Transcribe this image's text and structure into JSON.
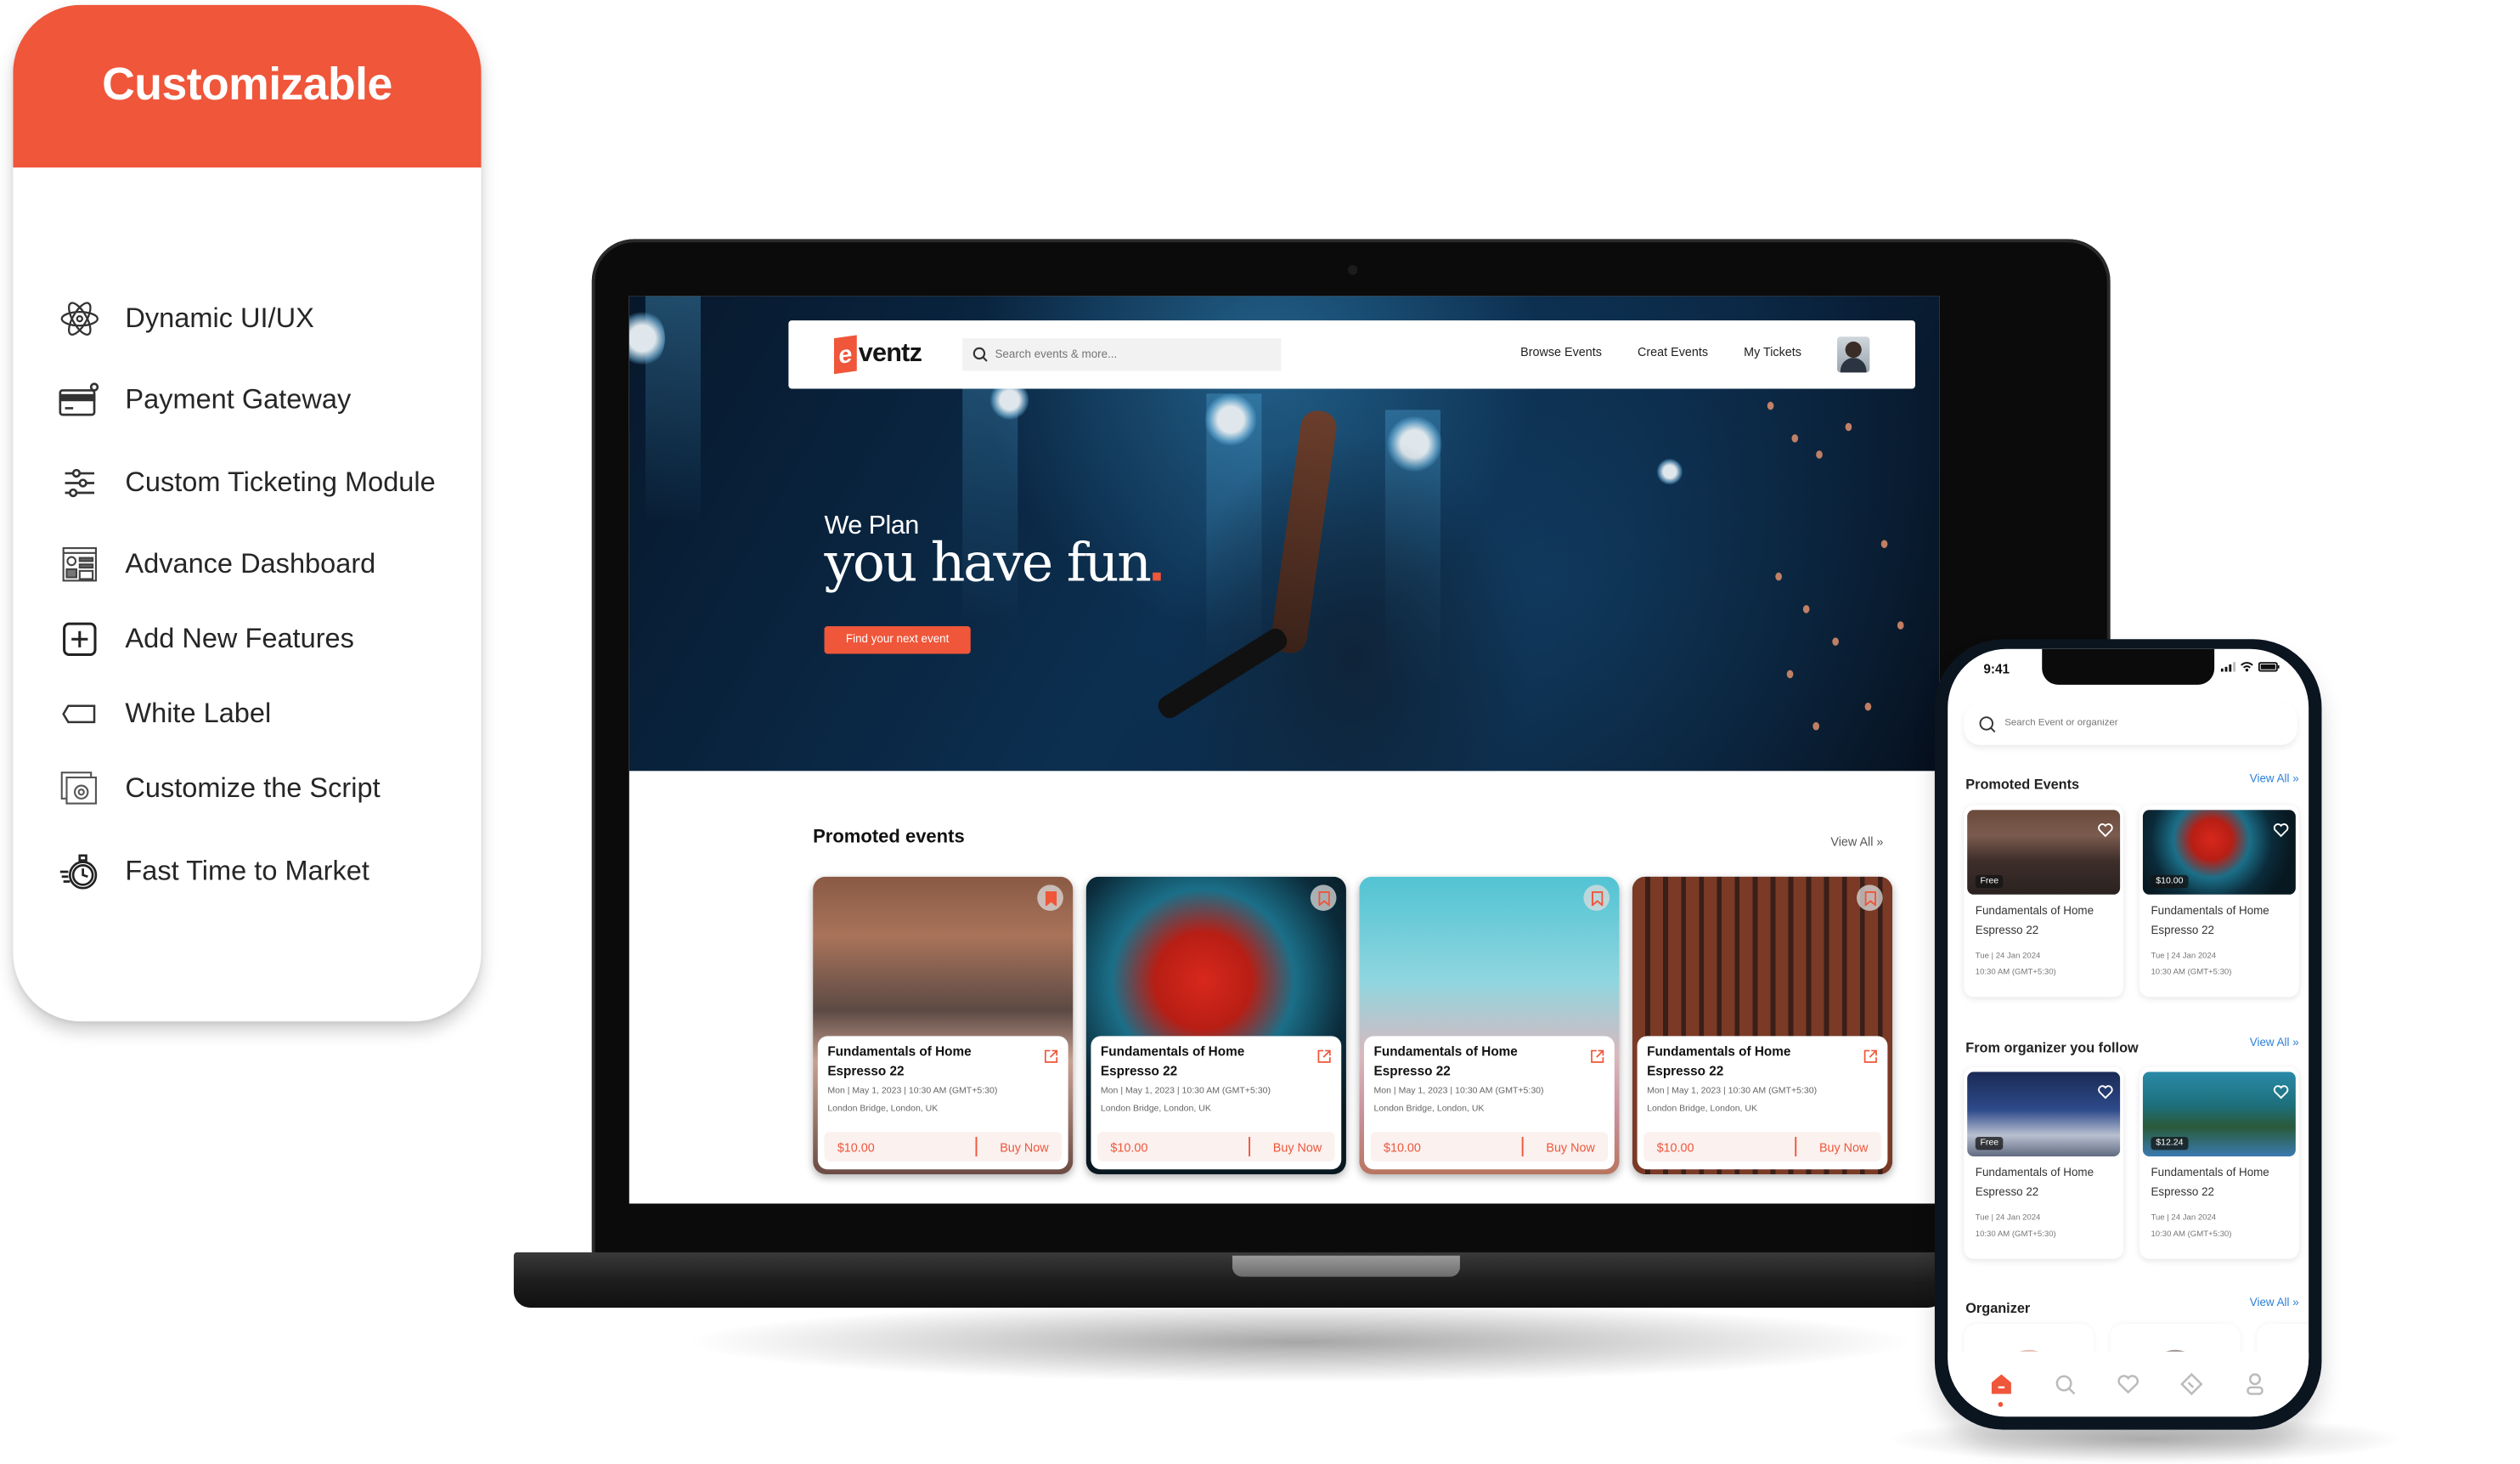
{
  "brand_color": "#ef563a",
  "link_color": "#2b7fd6",
  "feature_panel": {
    "title": "Customizable",
    "items": [
      {
        "icon": "atom-icon",
        "label": "Dynamic UI/UX"
      },
      {
        "icon": "credit-card-icon",
        "label": "Payment Gateway"
      },
      {
        "icon": "sliders-icon",
        "label": "Custom Ticketing Module"
      },
      {
        "icon": "dashboard-icon",
        "label": "Advance Dashboard"
      },
      {
        "icon": "plus-square-icon",
        "label": "Add New Features"
      },
      {
        "icon": "tag-label-icon",
        "label": "White Label"
      },
      {
        "icon": "window-gear-icon",
        "label": "Customize the Script"
      },
      {
        "icon": "stopwatch-icon",
        "label": "Fast Time to Market"
      }
    ]
  },
  "web_app": {
    "logo_letter": "e",
    "logo_rest": "ventz",
    "search": {
      "placeholder": "Search events & more...",
      "value": ""
    },
    "nav_links": [
      "Browse Events",
      "Creat Events",
      "My Tickets"
    ],
    "hero": {
      "subtitle": "We Plan",
      "title": "you have fun",
      "cta": "Find your next event"
    },
    "promoted": {
      "title": "Promoted events",
      "view_all": "View All »",
      "cards": [
        {
          "image": "party-lights",
          "bookmarked": true,
          "title": "Fundamentals of Home Espresso 22",
          "date": "Mon | May 1, 2023 | 10:30 AM (GMT+5:30)",
          "location": "London Bridge, London, UK",
          "price": "$10.00",
          "buy": "Buy Now"
        },
        {
          "image": "ferris-wheel",
          "bookmarked": false,
          "title": "Fundamentals of Home Espresso 22",
          "date": "Mon | May 1, 2023 | 10:30 AM (GMT+5:30)",
          "location": "London Bridge, London, UK",
          "price": "$10.00",
          "buy": "Buy Now"
        },
        {
          "image": "fair-balloons",
          "bookmarked": false,
          "title": "Fundamentals of Home Espresso 22",
          "date": "Mon | May 1, 2023 | 10:30 AM (GMT+5:30)",
          "location": "London Bridge, London, UK",
          "price": "$10.00",
          "buy": "Buy Now"
        },
        {
          "image": "brick-building",
          "bookmarked": false,
          "title": "Fundamentals of Home Espresso 22",
          "date": "Mon | May 1, 2023 | 10:30 AM (GMT+5:30)",
          "location": "London Bridge, London, UK",
          "price": "$10.00",
          "buy": "Buy Now"
        }
      ]
    }
  },
  "mobile_app": {
    "time": "9:41",
    "search": {
      "placeholder": "Search Event or organizer",
      "value": ""
    },
    "sections": [
      {
        "title": "Promoted Events",
        "view_all": "View All »",
        "cards": [
          {
            "image": "crowd-party",
            "badge": "Free",
            "title": "Fundamentals of Home Espresso 22",
            "date": "Tue | 24 Jan 2024",
            "time": "10:30 AM  (GMT+5:30)"
          },
          {
            "image": "ferris-wheel",
            "badge": "$10.00",
            "title": "Fundamentals of Home Espresso 22",
            "date": "Tue | 24 Jan 2024",
            "time": "10:30 AM  (GMT+5:30)"
          }
        ]
      },
      {
        "title": "From organizer you follow",
        "view_all": "View All »",
        "cards": [
          {
            "image": "conference",
            "badge": "Free",
            "title": "Fundamentals of Home Espresso 22",
            "date": "Tue | 24 Jan 2024",
            "time": "10:30 AM  (GMT+5:30)"
          },
          {
            "image": "festival-stage",
            "badge": "$12.24",
            "title": "Fundamentals of Home Espresso 22",
            "date": "Tue | 24 Jan 2024",
            "time": "10:30 AM  (GMT+5:30)"
          }
        ]
      },
      {
        "title": "Organizer",
        "view_all": "View All »"
      }
    ],
    "tabbar": [
      {
        "icon": "home-icon",
        "active": true
      },
      {
        "icon": "search-icon",
        "active": false
      },
      {
        "icon": "heart-icon",
        "active": false
      },
      {
        "icon": "ticket-icon",
        "active": false
      },
      {
        "icon": "profile-icon",
        "active": false
      }
    ]
  }
}
